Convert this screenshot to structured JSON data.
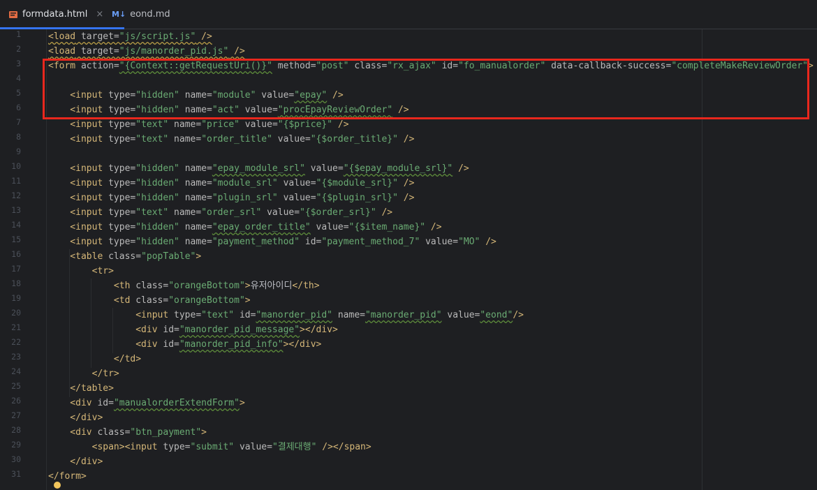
{
  "tabs": [
    {
      "name": "formdata.html",
      "active": true,
      "icon": "html-file-icon"
    },
    {
      "name": "eond.md",
      "active": false,
      "icon": "markdown-file-icon",
      "icon_text": "M↓"
    }
  ],
  "close_symbol": "×",
  "line_numbers": [
    "1",
    "2",
    "3",
    "4",
    "5",
    "6",
    "7",
    "8",
    "9",
    "10",
    "11",
    "12",
    "13",
    "14",
    "15",
    "16",
    "17",
    "18",
    "19",
    "20",
    "21",
    "22",
    "23",
    "24",
    "25",
    "26",
    "27",
    "28",
    "29",
    "30",
    "31"
  ],
  "code": {
    "l1": [
      "<load",
      " target=",
      "\"js/script.js\"",
      " />"
    ],
    "l2": [
      "<load",
      " target=",
      "\"js/manorder_pid.js\"",
      " />"
    ],
    "l3": [
      "<form",
      " action=",
      "\"{Context::getRequestUri()}\"",
      " method=",
      "\"post\"",
      " class=",
      "\"rx_ajax\"",
      " id=",
      "\"fo_manualorder\"",
      " data-callback-success=",
      "\"completeMakeReviewOrder\"",
      ">"
    ],
    "l5": [
      "    <input",
      " type=",
      "\"hidden\"",
      " name=",
      "\"module\"",
      " value=",
      "\"epay\"",
      " />"
    ],
    "l6": [
      "    <input",
      " type=",
      "\"hidden\"",
      " name=",
      "\"act\"",
      " value=",
      "\"procEpayReviewOrder\"",
      " />"
    ],
    "l7": [
      "    <input",
      " type=",
      "\"text\"",
      " name=",
      "\"price\"",
      " value=",
      "\"{$price}\"",
      " />"
    ],
    "l8": [
      "    <input",
      " type=",
      "\"text\"",
      " name=",
      "\"order_title\"",
      " value=",
      "\"{$order_title}\"",
      " />"
    ],
    "l10": [
      "    <input",
      " type=",
      "\"hidden\"",
      " name=",
      "\"epay_module_srl\"",
      " value=",
      "\"{$epay_module_srl}\"",
      " />"
    ],
    "l11": [
      "    <input",
      " type=",
      "\"hidden\"",
      " name=",
      "\"module_srl\"",
      " value=",
      "\"{$module_srl}\"",
      " />"
    ],
    "l12": [
      "    <input",
      " type=",
      "\"hidden\"",
      " name=",
      "\"plugin_srl\"",
      " value=",
      "\"{$plugin_srl}\"",
      " />"
    ],
    "l13": [
      "    <input",
      " type=",
      "\"text\"",
      " name=",
      "\"order_srl\"",
      " value=",
      "\"{$order_srl}\"",
      " />"
    ],
    "l14": [
      "    <input",
      " type=",
      "\"hidden\"",
      " name=",
      "\"epay_order_title\"",
      " value=",
      "\"{$item_name}\"",
      " />"
    ],
    "l15": [
      "    <input",
      " type=",
      "\"hidden\"",
      " name=",
      "\"payment_method\"",
      " id=",
      "\"payment_method_7\"",
      " value=",
      "\"MO\"",
      " />"
    ],
    "l16": [
      "    <table",
      " class=",
      "\"popTable\"",
      ">"
    ],
    "l17": [
      "        <tr>"
    ],
    "l18": [
      "            <th",
      " class=",
      "\"orangeBottom\"",
      ">",
      "유저아이디",
      "</th>"
    ],
    "l19": [
      "            <td",
      " class=",
      "\"orangeBottom\"",
      ">"
    ],
    "l20": [
      "                <input",
      " type=",
      "\"text\"",
      " id=",
      "\"manorder_pid\"",
      " name=",
      "\"manorder_pid\"",
      " value=",
      "\"eond\"",
      "/>"
    ],
    "l21": [
      "                <div",
      " id=",
      "\"manorder_pid_message\"",
      "></div>"
    ],
    "l22": [
      "                <div",
      " id=",
      "\"manorder_pid_info\"",
      "></div>"
    ],
    "l23": [
      "            </td>"
    ],
    "l24": [
      "        </tr>"
    ],
    "l25": [
      "    </table>"
    ],
    "l26": [
      "    <div",
      " id=",
      "\"manualorderExtendForm\"",
      ">"
    ],
    "l27": [
      "    </div>"
    ],
    "l28": [
      "    <div",
      " class=",
      "\"btn_payment\"",
      ">"
    ],
    "l29": [
      "        <span><input",
      " type=",
      "\"submit\"",
      " value=",
      "\"결제대행\"",
      " /></span>"
    ],
    "l30": [
      "    </div>"
    ],
    "l31": [
      "</form>"
    ]
  }
}
